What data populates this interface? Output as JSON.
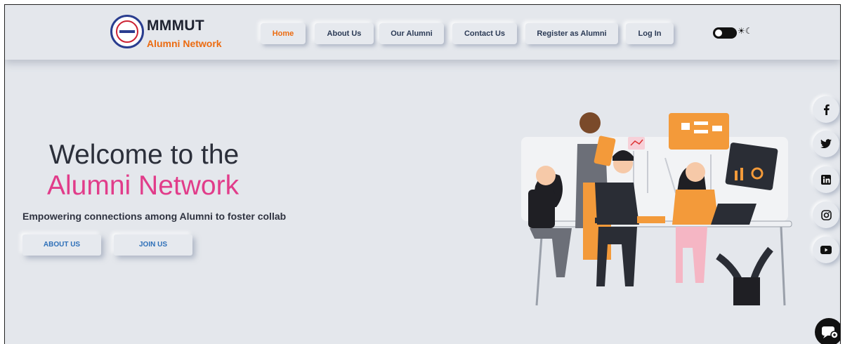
{
  "brand": {
    "title": "MMMUT",
    "subtitle": "Alumni Network"
  },
  "nav": {
    "items": [
      {
        "label": "Home",
        "active": true
      },
      {
        "label": "About Us"
      },
      {
        "label": "Our Alumni"
      },
      {
        "label": "Contact Us"
      },
      {
        "label": "Register as Alumni"
      },
      {
        "label": "Log In"
      }
    ],
    "theme_toggle_icons": "☀☾"
  },
  "hero": {
    "line1": "Welcome to the",
    "line2": "Alumni Network",
    "tagline": "Empowering connections among Alumni to foster collab",
    "buttons": [
      {
        "label": "ABOUT US"
      },
      {
        "label": "JOIN US"
      }
    ]
  },
  "social": {
    "icons": [
      "facebook-icon",
      "twitter-icon",
      "linkedin-icon",
      "instagram-icon",
      "youtube-icon"
    ]
  },
  "colors": {
    "accent": "#ec6b10",
    "pink": "#e13c8a",
    "link_blue": "#2d6fb8",
    "background": "#e4e7ec"
  }
}
